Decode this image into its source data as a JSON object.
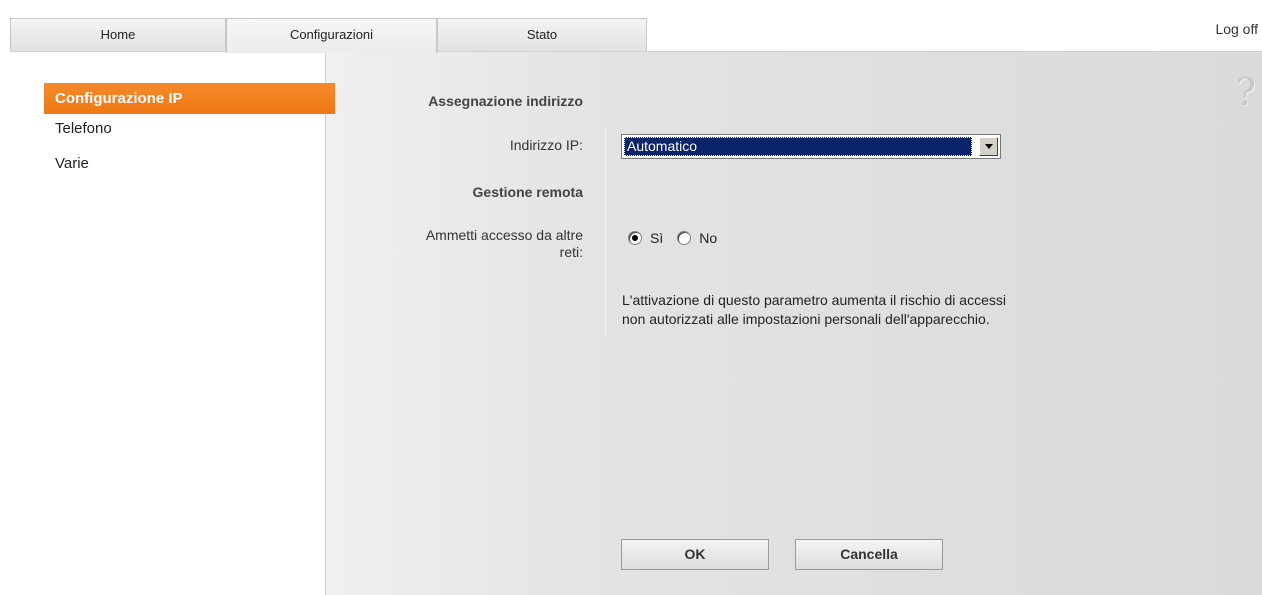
{
  "tabs": {
    "home": "Home",
    "config": "Configurazioni",
    "stato": "Stato"
  },
  "header": {
    "logoff": "Log off"
  },
  "sidebar": {
    "items": [
      {
        "label": "Configurazione IP"
      },
      {
        "label": "Telefono"
      },
      {
        "label": "Varie"
      }
    ]
  },
  "form": {
    "section1_title": "Assegnazione indirizzo",
    "ip_label": "Indirizzo IP:",
    "ip_value": "Automatico",
    "section2_title": "Gestione remota",
    "remote_label_line1": "Ammetti accesso da altre",
    "remote_label_line2": "reti:",
    "radio_yes": "Sì",
    "radio_no": "No",
    "radio_selected": "Sì",
    "note_line1": "L'attivazione di questo parametro aumenta il rischio di accessi",
    "note_line2": "non autorizzati alle impostazioni personali dell'apparecchio."
  },
  "buttons": {
    "ok": "OK",
    "cancel": "Cancella"
  },
  "help": {
    "icon": "question-mark-icon",
    "glyph": "?"
  },
  "colors": {
    "accent": "#f07a17",
    "selected_bg": "#0a246a"
  }
}
